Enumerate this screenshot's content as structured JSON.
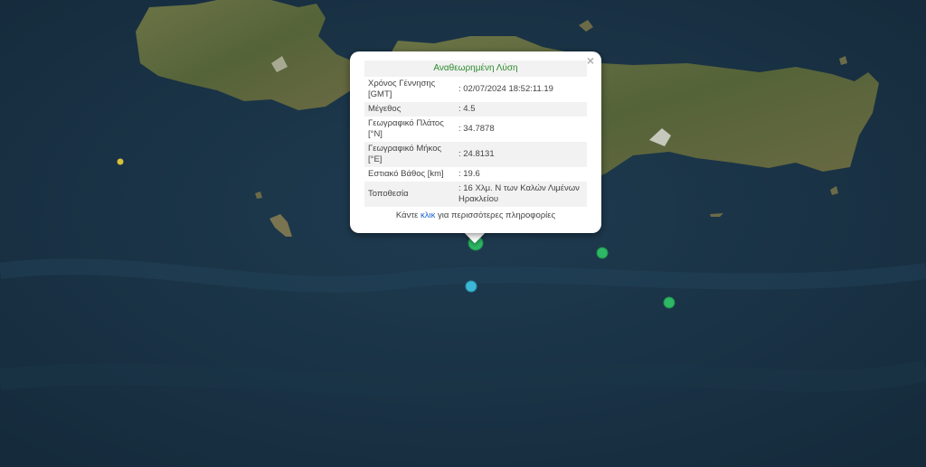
{
  "popup": {
    "header": "Αναθεωρημένη Λύση",
    "close_symbol": "×",
    "rows": [
      {
        "label": "Χρόνος Γέννησης [GMT]",
        "value": ": 02/07/2024 18:52:11.19"
      },
      {
        "label": "Μέγεθος",
        "value": ": 4.5"
      },
      {
        "label": "Γεωγραφικό Πλάτος [°N]",
        "value": ": 34.7878"
      },
      {
        "label": "Γεωγραφικό Μήκος [°E]",
        "value": ": 24.8131"
      },
      {
        "label": "Εστιακό Βάθος [km]",
        "value": ": 19.6"
      },
      {
        "label": "Τοποθεσία",
        "value": ": 16 Χλμ. Ν των Καλών Λιμένων Ηρακλείου"
      }
    ],
    "more_prefix": "Κάντε",
    "more_link": "κλικ",
    "more_suffix": "για περισσότερες πληροφορίες"
  },
  "map": {
    "sea_color": "#1b3448",
    "land_color": "#5f6a3c",
    "markers": [
      {
        "name": "selected-event",
        "color": "#2db865"
      },
      {
        "name": "event",
        "color": "#2db865"
      },
      {
        "name": "event",
        "color": "#2db865"
      },
      {
        "name": "event",
        "color": "#3bb8d6"
      },
      {
        "name": "event",
        "color": "#d6c23a"
      }
    ]
  }
}
